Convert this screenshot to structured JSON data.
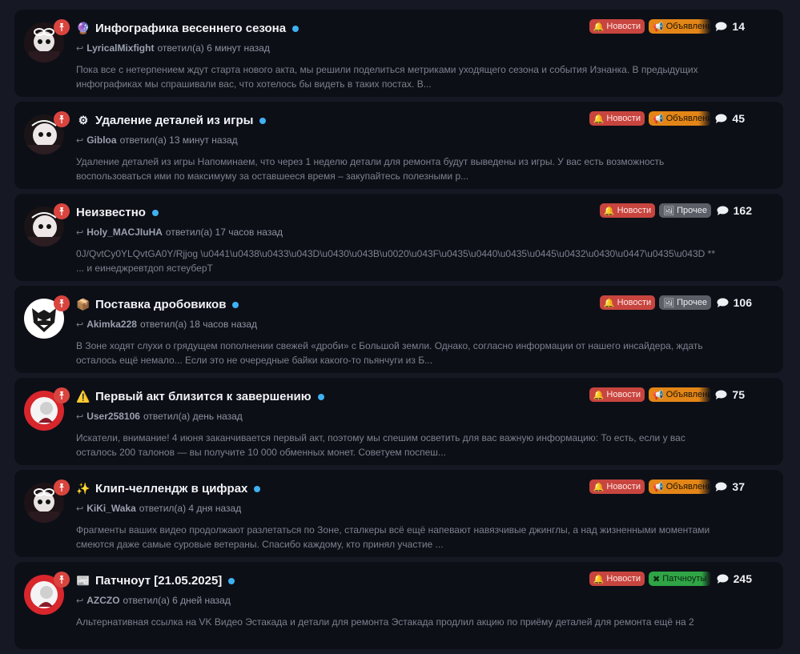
{
  "tag_labels": {
    "news": "Новости",
    "announce": "Объявления",
    "other": "Прочее",
    "patch": "Патчноуты"
  },
  "colors": {
    "pin": "#d9453e",
    "unread_dot": "#3fb1f2",
    "tag_news": "#c8453f",
    "tag_announce": "#e38617",
    "tag_other": "#5b5e67",
    "tag_patch": "#2fa545"
  },
  "topics": [
    {
      "emoji": "🔮",
      "title": "Инфографика весеннего сезона",
      "user": "LyricalMixfight",
      "replied": "ответил(а) 6 минут назад",
      "excerpt": "Пока все с нетерпением ждут старта нового акта, мы решили поделиться метриками уходящего сезона и события Изнанка. В предыдущих инфографиках мы спрашивали вас, что хотелось бы видеть в таких постах. В...",
      "comments": "14"
    },
    {
      "emoji": "⚙",
      "title": "Удаление деталей из игры",
      "user": "Gibloa",
      "replied": "ответил(а) 13 минут назад",
      "excerpt": "Удаление деталей из игры Напоминаем, что через 1 неделю детали для ремонта будут выведены из игры. У вас есть возможность воспользоваться ими по максимуму за оставшееся время – закупайтесь полезными р...",
      "comments": "45"
    },
    {
      "emoji": "",
      "title": "Неизвестно",
      "user": "Holy_MACJIuHA",
      "replied": "ответил(а) 17 часов назад",
      "excerpt": "0J/QvtCy0YLQvtGA0Y/Rjjog \\u0441\\u0438\\u0433\\u043D\\u0430\\u043B\\u0020\\u043F\\u0435\\u0440\\u0435\\u0445\\u0432\\u0430\\u0447\\u0435\\u043D ** ... и еинеджревтдоп ястеуберТ",
      "comments": "162"
    },
    {
      "emoji": "📦",
      "title": "Поставка дробовиков",
      "user": "Akimka228",
      "replied": "ответил(а) 18 часов назад",
      "excerpt": "В Зоне ходят слухи о грядущем пополнении свежей «дроби» с Большой земли. Однако, согласно информации от нашего инсайдера, ждать осталось ещё немало... Если это не очередные байки какого-то пьянчуги из Б...",
      "comments": "106"
    },
    {
      "emoji": "⚠️",
      "title": "Первый акт близится к завершению",
      "user": "User258106",
      "replied": "ответил(а) день назад",
      "excerpt": "Искатели, внимание! 4 июня заканчивается первый акт, поэтому мы спешим осветить для вас важную информацию: То есть, если у вас осталось 200 талонов — вы получите 10 000 обменных монет. Советуем поспеш...",
      "comments": "75"
    },
    {
      "emoji": "✨",
      "title": "Клип-челлендж в цифрах",
      "user": "KiKi_Waka",
      "replied": "ответил(а) 4 дня назад",
      "excerpt": "Фрагменты ваших видео продолжают разлетаться по Зоне, сталкеры всё ещё напевают навязчивые джинглы, а над жизненными моментами смеются даже самые суровые ветераны. Спасибо каждому, кто принял участие ...",
      "comments": "37"
    },
    {
      "emoji": "📰",
      "title": "Патчноут [21.05.2025]",
      "user": "AZCZO",
      "replied": "ответил(а) 6 дней назад",
      "excerpt": "Альтернативная ссылка на VK Видео Эстакада и детали для ремонта Эстакада продлил акцию по приёму деталей для ремонта ещё на 2",
      "comments": "245"
    }
  ]
}
